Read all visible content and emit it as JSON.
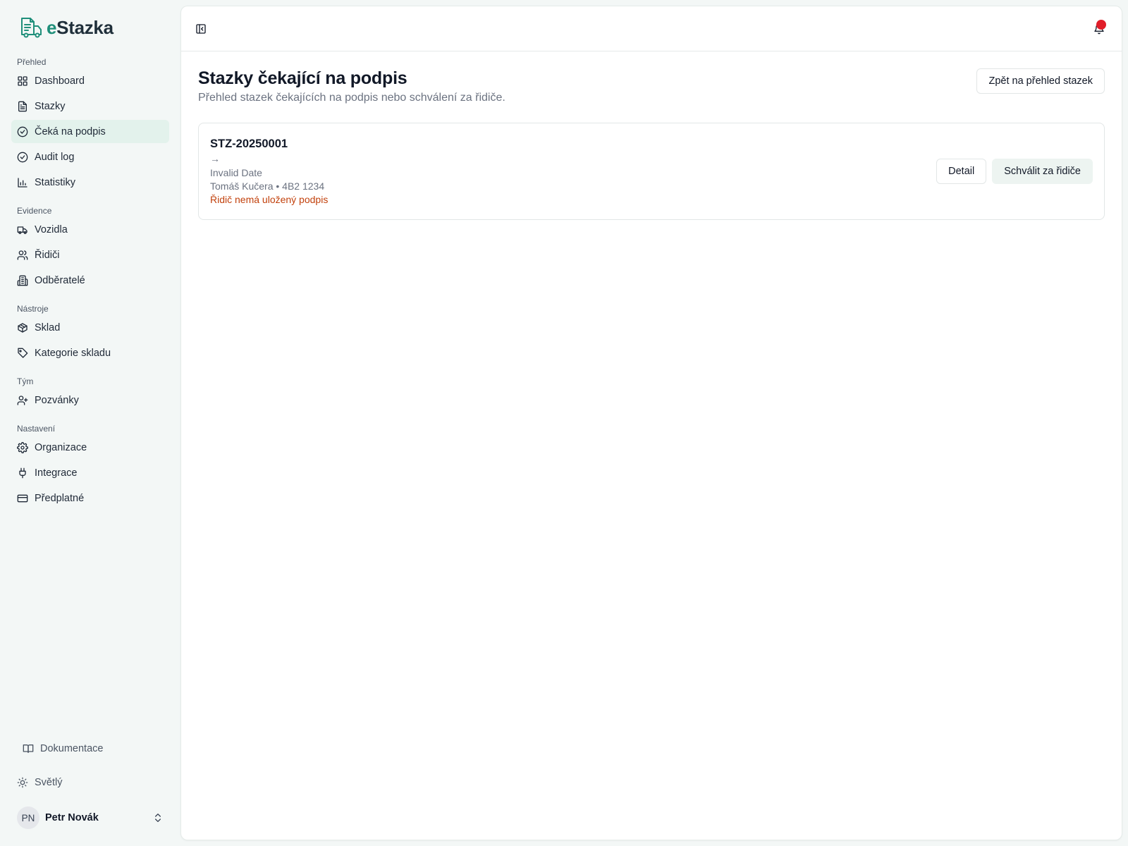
{
  "brand": {
    "prefix": "e",
    "name": "Stazka"
  },
  "sidebar": {
    "groups": [
      {
        "label": "Přehled",
        "items": [
          {
            "label": "Dashboard",
            "icon": "dashboard-icon"
          },
          {
            "label": "Stazky",
            "icon": "document-icon"
          },
          {
            "label": "Čeká na podpis",
            "icon": "check-circle-icon",
            "active": true
          },
          {
            "label": "Audit log",
            "icon": "check-circle-icon"
          },
          {
            "label": "Statistiky",
            "icon": "bar-chart-icon"
          }
        ]
      },
      {
        "label": "Evidence",
        "items": [
          {
            "label": "Vozidla",
            "icon": "truck-icon"
          },
          {
            "label": "Řidiči",
            "icon": "users-icon"
          },
          {
            "label": "Odběratelé",
            "icon": "building-icon"
          }
        ]
      },
      {
        "label": "Nástroje",
        "items": [
          {
            "label": "Sklad",
            "icon": "package-icon"
          },
          {
            "label": "Kategorie skladu",
            "icon": "tag-icon"
          }
        ]
      },
      {
        "label": "Tým",
        "items": [
          {
            "label": "Pozvánky",
            "icon": "user-plus-icon"
          }
        ]
      },
      {
        "label": "Nastavení",
        "items": [
          {
            "label": "Organizace",
            "icon": "gear-icon"
          },
          {
            "label": "Integrace",
            "icon": "plug-icon"
          },
          {
            "label": "Předplatné",
            "icon": "credit-card-icon"
          }
        ]
      }
    ],
    "docs_label": "Dokumentace",
    "theme_label": "Světlý",
    "user": {
      "initials": "PN",
      "name": "Petr Novák"
    }
  },
  "page": {
    "title": "Stazky čekající na podpis",
    "subtitle": "Přehled stazek čekajících na podpis nebo schválení za řidiče.",
    "back_button": "Zpět na přehled stazek"
  },
  "cards": [
    {
      "id": "STZ-20250001",
      "route": "→",
      "date": "Invalid Date",
      "driver": "Tomáš Kučera • 4B2 1234",
      "warning": "Řidič nemá uložený podpis",
      "detail_label": "Detail",
      "approve_label": "Schválit za řidiče"
    }
  ],
  "colors": {
    "accent": "#1f8f7a",
    "active_bg": "#e3f2ec",
    "warning": "#c2410c",
    "notification_dot": "#e11d29"
  }
}
